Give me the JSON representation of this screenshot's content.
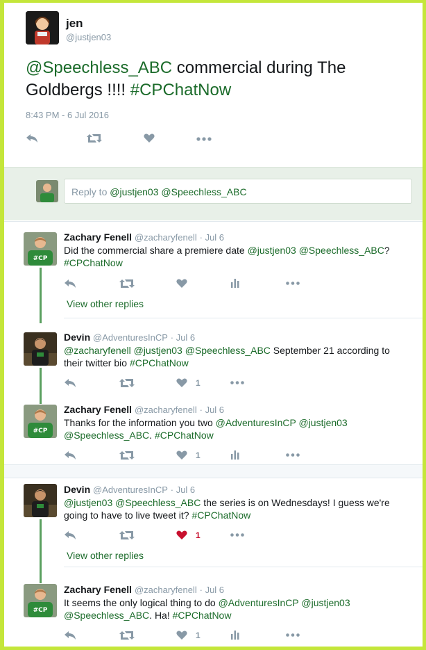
{
  "main_tweet": {
    "name": "jen",
    "handle": "@justjen03",
    "text_mention": "@Speechless_ABC",
    "text_middle": " commercial during The Goldbergs !!!! ",
    "text_hashtag": "#CPChatNow",
    "timestamp": "8:43 PM - 6 Jul 2016"
  },
  "reply_box": {
    "prefix": "Reply to ",
    "mentions": "@justjen03 @Speechless_ABC"
  },
  "replies": [
    {
      "name": "Zachary Fenell",
      "handle": "@zacharyfenell",
      "date": "· Jul 6",
      "text_plain1": "Did the commercial share a premiere date ",
      "mentions": "@justjen03 @Speechless_ABC",
      "text_plain2": "?",
      "hashtag": "#CPChatNow",
      "like_count": "",
      "view_replies": "View other replies"
    },
    {
      "name": "Devin",
      "handle": "@AdventuresInCP",
      "date": "· Jul 6",
      "mentions": "@zacharyfenell @justjen03 @Speechless_ABC",
      "text_plain1": " September 21 according to their twitter bio ",
      "hashtag": "#CPChatNow",
      "like_count": "1"
    },
    {
      "name": "Zachary Fenell",
      "handle": "@zacharyfenell",
      "date": "· Jul 6",
      "text_plain1": "Thanks for the information you two ",
      "mentions": "@AdventuresInCP @justjen03 @Speechless_ABC",
      "text_plain2": ". ",
      "hashtag": "#CPChatNow",
      "like_count": "1"
    },
    {
      "name": "Devin",
      "handle": "@AdventuresInCP",
      "date": "· Jul 6",
      "mentions": "@justjen03 @Speechless_ABC",
      "text_plain1": " the series is on Wednesdays! I guess we're going to have to live tweet it? ",
      "hashtag": "#CPChatNow",
      "like_count": "1",
      "view_replies": "View other replies"
    },
    {
      "name": "Zachary Fenell",
      "handle": "@zacharyfenell",
      "date": "· Jul 6",
      "text_plain1": "It seems the only logical thing to do ",
      "mentions": "@AdventuresInCP @justjen03 @Speechless_ABC",
      "text_plain2": ". Ha! ",
      "hashtag": "#CPChatNow",
      "like_count": "1"
    }
  ],
  "colors": {
    "frame_border": "#c4e63a",
    "link_green": "#1b6b2a",
    "thread_line": "#5aa05f",
    "like_active": "#c8102e"
  },
  "icons": [
    "reply-icon",
    "retweet-icon",
    "heart-icon",
    "analytics-icon",
    "more-icon"
  ]
}
